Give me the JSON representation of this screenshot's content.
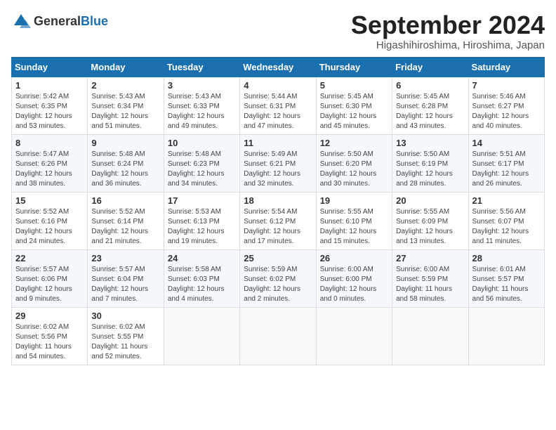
{
  "header": {
    "logo_general": "General",
    "logo_blue": "Blue",
    "month": "September 2024",
    "location": "Higashihiroshima, Hiroshima, Japan"
  },
  "weekdays": [
    "Sunday",
    "Monday",
    "Tuesday",
    "Wednesday",
    "Thursday",
    "Friday",
    "Saturday"
  ],
  "weeks": [
    [
      {
        "day": "1",
        "sunrise": "5:42 AM",
        "sunset": "6:35 PM",
        "daylight": "12 hours and 53 minutes."
      },
      {
        "day": "2",
        "sunrise": "5:43 AM",
        "sunset": "6:34 PM",
        "daylight": "12 hours and 51 minutes."
      },
      {
        "day": "3",
        "sunrise": "5:43 AM",
        "sunset": "6:33 PM",
        "daylight": "12 hours and 49 minutes."
      },
      {
        "day": "4",
        "sunrise": "5:44 AM",
        "sunset": "6:31 PM",
        "daylight": "12 hours and 47 minutes."
      },
      {
        "day": "5",
        "sunrise": "5:45 AM",
        "sunset": "6:30 PM",
        "daylight": "12 hours and 45 minutes."
      },
      {
        "day": "6",
        "sunrise": "5:45 AM",
        "sunset": "6:28 PM",
        "daylight": "12 hours and 43 minutes."
      },
      {
        "day": "7",
        "sunrise": "5:46 AM",
        "sunset": "6:27 PM",
        "daylight": "12 hours and 40 minutes."
      }
    ],
    [
      {
        "day": "8",
        "sunrise": "5:47 AM",
        "sunset": "6:26 PM",
        "daylight": "12 hours and 38 minutes."
      },
      {
        "day": "9",
        "sunrise": "5:48 AM",
        "sunset": "6:24 PM",
        "daylight": "12 hours and 36 minutes."
      },
      {
        "day": "10",
        "sunrise": "5:48 AM",
        "sunset": "6:23 PM",
        "daylight": "12 hours and 34 minutes."
      },
      {
        "day": "11",
        "sunrise": "5:49 AM",
        "sunset": "6:21 PM",
        "daylight": "12 hours and 32 minutes."
      },
      {
        "day": "12",
        "sunrise": "5:50 AM",
        "sunset": "6:20 PM",
        "daylight": "12 hours and 30 minutes."
      },
      {
        "day": "13",
        "sunrise": "5:50 AM",
        "sunset": "6:19 PM",
        "daylight": "12 hours and 28 minutes."
      },
      {
        "day": "14",
        "sunrise": "5:51 AM",
        "sunset": "6:17 PM",
        "daylight": "12 hours and 26 minutes."
      }
    ],
    [
      {
        "day": "15",
        "sunrise": "5:52 AM",
        "sunset": "6:16 PM",
        "daylight": "12 hours and 24 minutes."
      },
      {
        "day": "16",
        "sunrise": "5:52 AM",
        "sunset": "6:14 PM",
        "daylight": "12 hours and 21 minutes."
      },
      {
        "day": "17",
        "sunrise": "5:53 AM",
        "sunset": "6:13 PM",
        "daylight": "12 hours and 19 minutes."
      },
      {
        "day": "18",
        "sunrise": "5:54 AM",
        "sunset": "6:12 PM",
        "daylight": "12 hours and 17 minutes."
      },
      {
        "day": "19",
        "sunrise": "5:55 AM",
        "sunset": "6:10 PM",
        "daylight": "12 hours and 15 minutes."
      },
      {
        "day": "20",
        "sunrise": "5:55 AM",
        "sunset": "6:09 PM",
        "daylight": "12 hours and 13 minutes."
      },
      {
        "day": "21",
        "sunrise": "5:56 AM",
        "sunset": "6:07 PM",
        "daylight": "12 hours and 11 minutes."
      }
    ],
    [
      {
        "day": "22",
        "sunrise": "5:57 AM",
        "sunset": "6:06 PM",
        "daylight": "12 hours and 9 minutes."
      },
      {
        "day": "23",
        "sunrise": "5:57 AM",
        "sunset": "6:04 PM",
        "daylight": "12 hours and 7 minutes."
      },
      {
        "day": "24",
        "sunrise": "5:58 AM",
        "sunset": "6:03 PM",
        "daylight": "12 hours and 4 minutes."
      },
      {
        "day": "25",
        "sunrise": "5:59 AM",
        "sunset": "6:02 PM",
        "daylight": "12 hours and 2 minutes."
      },
      {
        "day": "26",
        "sunrise": "6:00 AM",
        "sunset": "6:00 PM",
        "daylight": "12 hours and 0 minutes."
      },
      {
        "day": "27",
        "sunrise": "6:00 AM",
        "sunset": "5:59 PM",
        "daylight": "11 hours and 58 minutes."
      },
      {
        "day": "28",
        "sunrise": "6:01 AM",
        "sunset": "5:57 PM",
        "daylight": "11 hours and 56 minutes."
      }
    ],
    [
      {
        "day": "29",
        "sunrise": "6:02 AM",
        "sunset": "5:56 PM",
        "daylight": "11 hours and 54 minutes."
      },
      {
        "day": "30",
        "sunrise": "6:02 AM",
        "sunset": "5:55 PM",
        "daylight": "11 hours and 52 minutes."
      },
      null,
      null,
      null,
      null,
      null
    ]
  ]
}
